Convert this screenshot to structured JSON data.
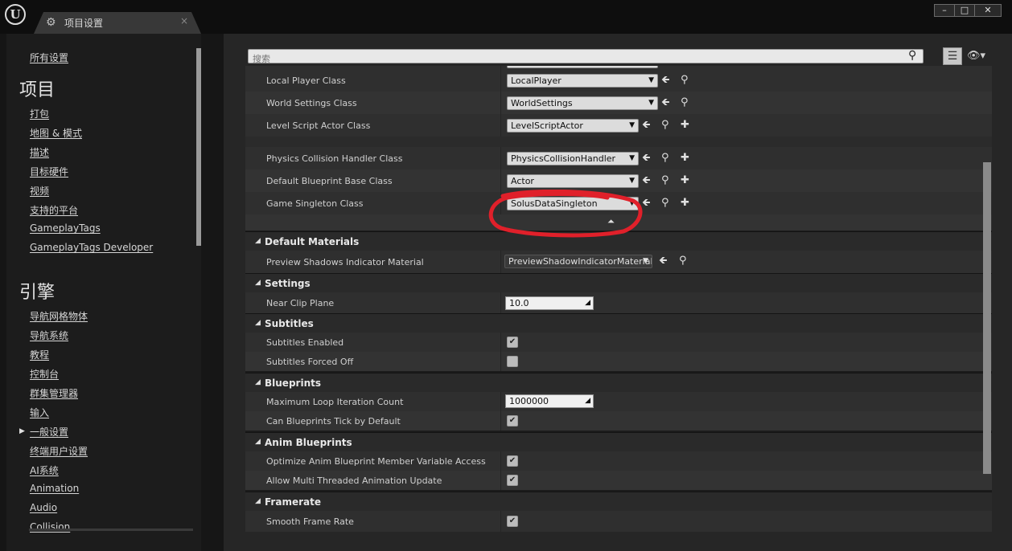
{
  "window": {
    "logo_letter": "U",
    "tab_label": "项目设置",
    "tab_close": "×",
    "minimize": "–",
    "maximize": "□",
    "close": "✕"
  },
  "nav": {
    "all_settings": "所有设置",
    "project_heading": "项目",
    "project_items": [
      "打包",
      "地图 & 模式",
      "描述",
      "目标硬件",
      "视频",
      "支持的平台",
      "GameplayTags",
      "GameplayTags Developer"
    ],
    "engine_heading": "引擎",
    "engine_items": [
      "导航网格物体",
      "导航系统",
      "教程",
      "控制台",
      "群集管理器",
      "输入",
      "一般设置",
      "终端用户设置",
      "AI系统",
      "Animation",
      "Audio",
      "Collision"
    ],
    "selected_arrow": "▶"
  },
  "search": {
    "placeholder": "搜索"
  },
  "rows_top": [
    {
      "label": "Local Player Class",
      "value": "LocalPlayer"
    },
    {
      "label": "World Settings Class",
      "value": "WorldSettings"
    },
    {
      "label": "Level Script Actor Class",
      "value": "LevelScriptActor"
    }
  ],
  "rows_classes": [
    {
      "label": "Physics Collision Handler Class",
      "value": "PhysicsCollisionHandler"
    },
    {
      "label": "Default Blueprint Base Class",
      "value": "Actor"
    },
    {
      "label": "Game Singleton Class",
      "value": "SolusDataSingleton"
    }
  ],
  "categories": {
    "default_materials": "Default Materials",
    "settings": "Settings",
    "subtitles": "Subtitles",
    "blueprints": "Blueprints",
    "anim_blueprints": "Anim Blueprints",
    "framerate": "Framerate"
  },
  "preview_shadows": {
    "label": "Preview Shadows Indicator Material",
    "value": "PreviewShadowIndicatorMaterial"
  },
  "near_clip": {
    "label": "Near Clip Plane",
    "value": "10.0"
  },
  "subtitles_enabled": {
    "label": "Subtitles Enabled",
    "checked": true
  },
  "subtitles_forced_off": {
    "label": "Subtitles Forced Off",
    "checked": false
  },
  "max_loop": {
    "label": "Maximum Loop Iteration Count",
    "value": "1000000"
  },
  "bp_tick": {
    "label": "Can Blueprints Tick by Default",
    "checked": true
  },
  "optimize_anim": {
    "label": "Optimize Anim Blueprint Member Variable Access",
    "checked": true
  },
  "multi_thread_anim": {
    "label": "Allow Multi Threaded Animation Update",
    "checked": true
  },
  "smooth_frame": {
    "label": "Smooth Frame Rate",
    "checked": true
  },
  "glyphs": {
    "arrow_down": "▼",
    "category_arrow": "◢",
    "check": "✔",
    "use_selected": "🡸",
    "browse": "⚲",
    "add": "✚",
    "collapse": "⏶",
    "spin": "◢"
  },
  "colors": {
    "annotation": "#e0202a"
  }
}
